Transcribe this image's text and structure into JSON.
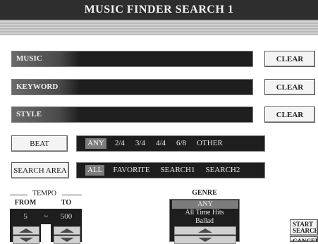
{
  "title": "MUSIC FINDER SEARCH 1",
  "fields": [
    {
      "label": "MUSIC",
      "clear_label": "CLEAR"
    },
    {
      "label": "KEYWORD",
      "clear_label": "CLEAR"
    },
    {
      "label": "STYLE",
      "clear_label": "CLEAR"
    }
  ],
  "beat": {
    "label": "BEAT",
    "options": [
      "ANY",
      "2/4",
      "3/4",
      "4/4",
      "6/8",
      "OTHER"
    ],
    "selected": "ANY"
  },
  "search_area": {
    "label": "SEARCH AREA",
    "options": [
      "ALL",
      "FAVORITE",
      "SEARCH1",
      "SEARCH2"
    ],
    "selected": "ALL"
  },
  "tempo": {
    "label": "TEMPO",
    "from_label": "FROM",
    "to_label": "TO",
    "from_value": "5",
    "separator": "~",
    "to_value": "500"
  },
  "genre": {
    "label": "GENRE",
    "items": [
      "ANY",
      "All Time Hits",
      "Ballad"
    ],
    "selected": "ANY"
  },
  "side_buttons": {
    "start_line1": "START",
    "start_line2": "SEARCH",
    "cancel": "CANCEL"
  },
  "colors": {
    "panel_dark": "#1e1e1e",
    "selected_gray": "#7c7c7c",
    "button_face": "#f4f4f4"
  }
}
